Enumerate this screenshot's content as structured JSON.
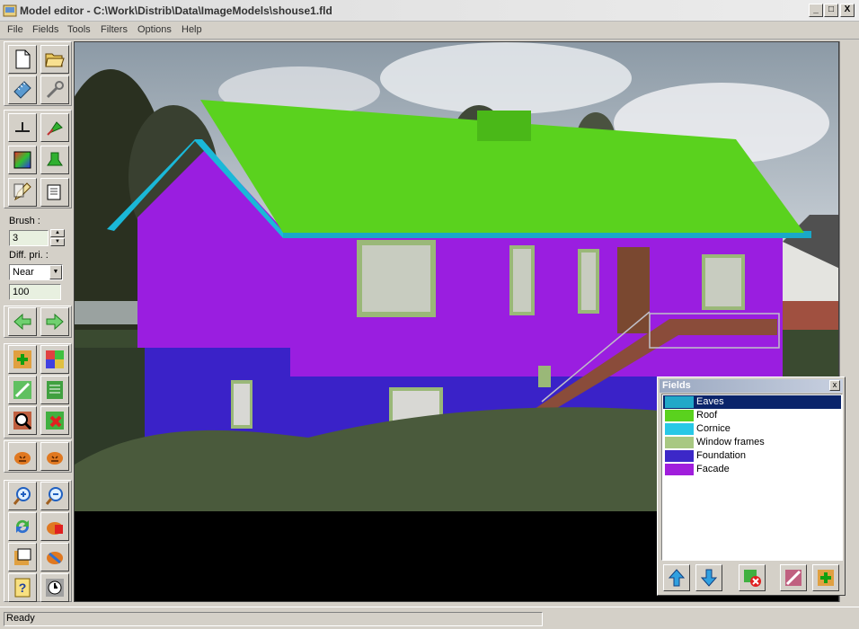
{
  "window": {
    "title": "Model editor - C:\\Work\\Distrib\\Data\\ImageModels\\shouse1.fld",
    "minimize": "_",
    "maximize": "□",
    "close": "X"
  },
  "menu": [
    "File",
    "Fields",
    "Tools",
    "Filters",
    "Options",
    "Help"
  ],
  "toolbar": {
    "brush_label": "Brush :",
    "brush_value": "3",
    "diff_label": "Diff. pri. :",
    "diff_option": "Near",
    "diff_value": "100"
  },
  "fields_panel": {
    "title": "Fields",
    "close": "x",
    "items": [
      {
        "name": "Eaves",
        "color": "#22a8c8",
        "selected": true
      },
      {
        "name": "Roof",
        "color": "#5ad21e",
        "selected": false
      },
      {
        "name": "Cornice",
        "color": "#28c8e6",
        "selected": false
      },
      {
        "name": "Window frames",
        "color": "#a8c882",
        "selected": false
      },
      {
        "name": "Foundation",
        "color": "#3c28c8",
        "selected": false
      },
      {
        "name": "Facade",
        "color": "#a01edc",
        "selected": false
      }
    ]
  },
  "status": {
    "text": "Ready"
  },
  "colors": {
    "facade": "#9a1ee0",
    "roof": "#5ad21e",
    "foundation": "#3a22c8",
    "eaves": "#1aa8c8",
    "window_frames": "#9ab878"
  }
}
